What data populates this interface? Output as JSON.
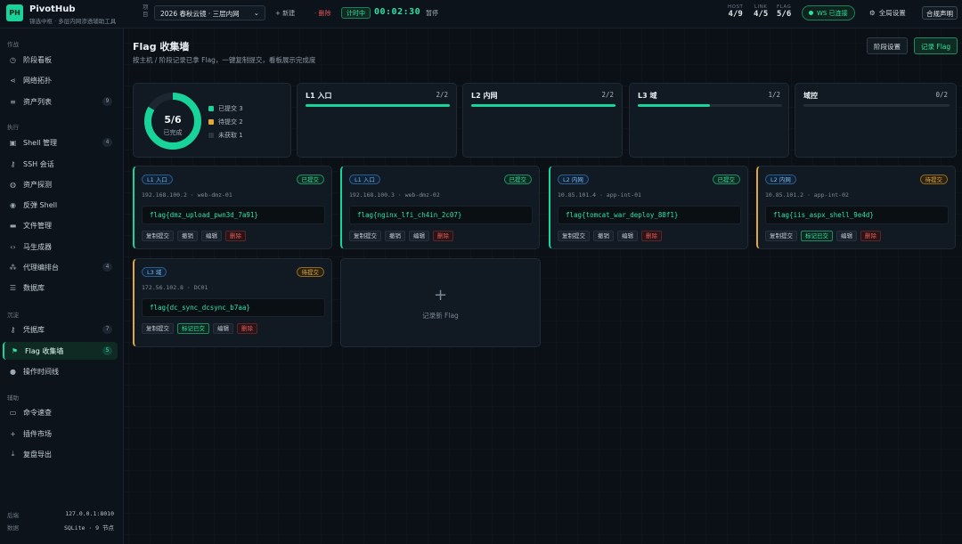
{
  "brand": {
    "logo": "PH",
    "title": "PivotHub",
    "subtitle": "锦选中枢 · 多层内网渗透辅助工具"
  },
  "topbar": {
    "project_label": "项目",
    "project": "2026 春秋云镜 · 三层内网",
    "new": "+ 新建",
    "delete": "· 删除",
    "timer_status": "计时中",
    "timer": "00:02:30",
    "pause": "暂停",
    "stats": [
      {
        "label": "HOST",
        "value": "4/9"
      },
      {
        "label": "LINK",
        "value": "4/5"
      },
      {
        "label": "FLAG",
        "value": "5/6"
      }
    ],
    "ws": "WS 已连接",
    "settings": "全局设置",
    "compliance": "合规声明"
  },
  "sidebar": {
    "sections": [
      "作战",
      "执行",
      "沉淀",
      "辅助"
    ],
    "items": [
      {
        "label": "阶段看板",
        "icon": "clock-icon",
        "glyph": "◷",
        "count": ""
      },
      {
        "label": "网络拓扑",
        "icon": "share-icon",
        "glyph": "⋖",
        "count": ""
      },
      {
        "label": "资产列表",
        "icon": "list-icon",
        "glyph": "≡",
        "count": "9"
      },
      {
        "label": "Shell 管理",
        "icon": "terminal-icon",
        "glyph": "▣",
        "count": "4"
      },
      {
        "label": "SSH 会话",
        "icon": "key-icon",
        "glyph": "⚷",
        "count": ""
      },
      {
        "label": "资产探测",
        "icon": "globe-icon",
        "glyph": "◍",
        "count": ""
      },
      {
        "label": "反弹 Shell",
        "icon": "target-icon",
        "glyph": "◉",
        "count": ""
      },
      {
        "label": "文件管理",
        "icon": "folder-icon",
        "glyph": "▬",
        "count": ""
      },
      {
        "label": "马生成器",
        "icon": "code-icon",
        "glyph": "‹›",
        "count": ""
      },
      {
        "label": "代理编排台",
        "icon": "network-icon",
        "glyph": "⁂",
        "count": "4"
      },
      {
        "label": "数据库",
        "icon": "database-icon",
        "glyph": "☰",
        "count": ""
      },
      {
        "label": "凭据库",
        "icon": "credential-key-icon",
        "glyph": "⚷",
        "count": "7"
      },
      {
        "label": "Flag 收集墙",
        "icon": "flag-icon",
        "glyph": "⚑",
        "count": "5"
      },
      {
        "label": "操作时间线",
        "icon": "timeline-icon",
        "glyph": "●",
        "count": ""
      },
      {
        "label": "命令速查",
        "icon": "keyboard-icon",
        "glyph": "▭",
        "count": ""
      },
      {
        "label": "插件市场",
        "icon": "plus-icon",
        "glyph": "+",
        "count": ""
      },
      {
        "label": "复盘导出",
        "icon": "download-icon",
        "glyph": "⤓",
        "count": ""
      }
    ],
    "footer": [
      {
        "label": "后端",
        "value": "127.0.0.1:8010"
      },
      {
        "label": "数据",
        "value": "SQLite · 9 节点"
      }
    ]
  },
  "main": {
    "title": "Flag 收集墙",
    "subtitle": "按主机 / 阶段记录已拿 Flag，一键复制提交，看板展示完成度",
    "btn_stage": "阶段设置",
    "btn_record": "记录 Flag"
  },
  "summary": {
    "ratio": "5/6",
    "label": "已完成",
    "captured": 5,
    "total": 6,
    "legend": [
      {
        "label": "已提交 3",
        "color": "#19d49a"
      },
      {
        "label": "待提交 2",
        "color": "#e2a73a"
      },
      {
        "label": "未获取 1",
        "color": "#2a3540"
      }
    ]
  },
  "stages": [
    {
      "name": "L1 入口",
      "count": "2/2",
      "progress": 1.0
    },
    {
      "name": "L2 内网",
      "count": "2/2",
      "progress": 1.0
    },
    {
      "name": "L3 域",
      "count": "1/2",
      "progress": 0.5
    },
    {
      "name": "域控",
      "count": "0/2",
      "progress": 0
    }
  ],
  "flags": [
    {
      "stage": "L1 入口",
      "status": "已提交",
      "host": "192.168.100.2 · web-dmz-01",
      "flag": "flag{dmz_upload_pwn3d_7a91}",
      "actions": [
        "复制提交",
        "撤销",
        "编辑",
        "删除"
      ]
    },
    {
      "stage": "L1 入口",
      "status": "已提交",
      "host": "192.168.100.3 · web-dmz-02",
      "flag": "flag{nginx_lfi_ch4in_2c07}",
      "actions": [
        "复制提交",
        "撤销",
        "编辑",
        "删除"
      ]
    },
    {
      "stage": "L2 内网",
      "status": "已提交",
      "host": "10.85.101.4 · app-int-01",
      "flag": "flag{tomcat_war_deploy_88f1}",
      "actions": [
        "复制提交",
        "撤销",
        "编辑",
        "删除"
      ]
    },
    {
      "stage": "L2 内网",
      "status": "待提交",
      "host": "10.85.101.2 · app-int-02",
      "flag": "flag{iis_aspx_shell_9e4d}",
      "actions": [
        "复制提交",
        "标记已交",
        "编辑",
        "删除"
      ]
    },
    {
      "stage": "L3 域",
      "status": "待提交",
      "host": "172.56.102.8 · DC01",
      "flag": "flag{dc_sync_dcsync_b7aa}",
      "actions": [
        "复制提交",
        "标记已交",
        "编辑",
        "删除"
      ]
    }
  ],
  "add_card": {
    "icon": "+",
    "label": "记录新 Flag"
  }
}
